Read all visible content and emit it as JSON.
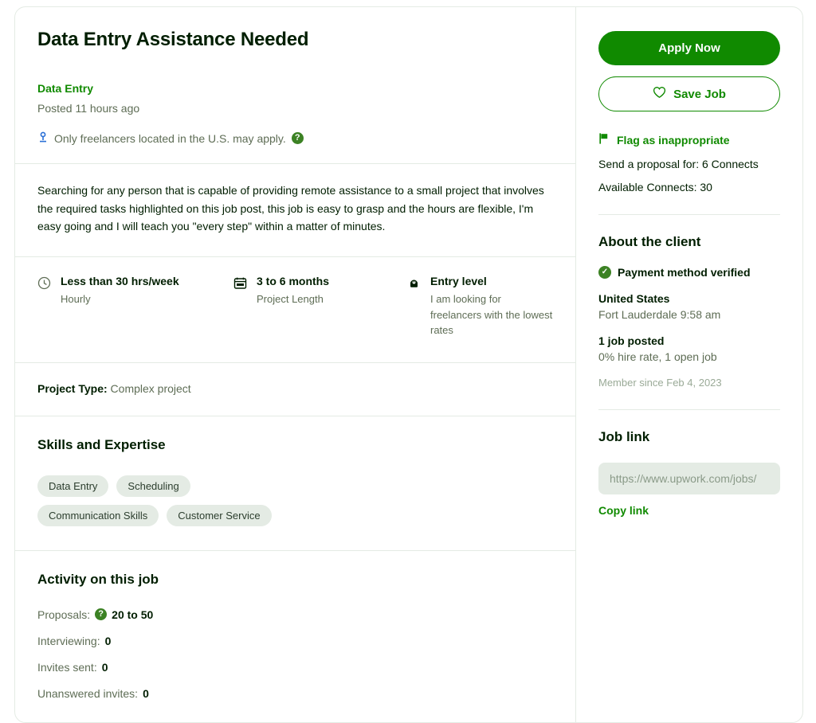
{
  "job": {
    "title": "Data Entry Assistance Needed",
    "category": "Data Entry",
    "posted": "Posted 11 hours ago",
    "location_note": "Only freelancers located in the U.S. may apply.",
    "help_glyph": "?",
    "description": "Searching for any person that is capable of providing remote assistance to a small project that involves the required tasks highlighted on this job post, this job is easy to grasp and the hours are flexible, I'm easy going and I will teach you \"every step\" within a matter of minutes.",
    "project_type_label": "Project Type:",
    "project_type_value": "Complex project"
  },
  "features": [
    {
      "icon": "clock-icon",
      "title": "Less than 30 hrs/week",
      "sub": "Hourly"
    },
    {
      "icon": "calendar-icon",
      "title": "3 to 6 months",
      "sub": "Project Length"
    },
    {
      "icon": "experience-level-icon",
      "title": "Entry level",
      "sub": "I am looking for freelancers with the lowest rates"
    }
  ],
  "skills": {
    "heading": "Skills and Expertise",
    "items": [
      "Data Entry",
      "Scheduling",
      "Communication Skills",
      "Customer Service"
    ]
  },
  "activity": {
    "heading": "Activity on this job",
    "proposals_label": "Proposals:",
    "proposals_value": "20 to 50",
    "rows": [
      {
        "label": "Interviewing:",
        "value": "0"
      },
      {
        "label": "Invites sent:",
        "value": "0"
      },
      {
        "label": "Unanswered invites:",
        "value": "0"
      }
    ]
  },
  "sidebar": {
    "apply_label": "Apply Now",
    "save_label": "Save Job",
    "flag_label": "Flag as inappropriate",
    "send_proposal": "Send a proposal for: 6 Connects",
    "available_connects": "Available Connects: 30",
    "client_heading": "About the client",
    "payment_verified": "Payment method verified",
    "country": "United States",
    "city_time": "Fort Lauderdale 9:58 am",
    "jobs_posted": "1 job posted",
    "hire_rate": "0% hire rate, 1 open job",
    "member_since": "Member since Feb 4, 2023",
    "job_link_heading": "Job link",
    "job_link_value": "https://www.upwork.com/jobs/",
    "copy_link_label": "Copy link"
  },
  "colors": {
    "primary_green": "#108a00",
    "accent_green": "#3c8224",
    "pill_bg": "#e4ebe4",
    "muted_text": "#5e6d55"
  }
}
